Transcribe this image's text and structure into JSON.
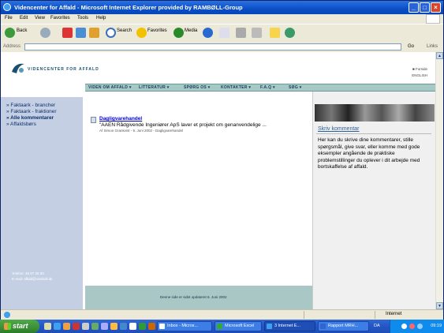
{
  "window": {
    "title": "Videncenter for Affald - Microsoft Internet Explorer provided by RAMBØLL-Group",
    "buttons": {
      "min": "_",
      "max": "□",
      "close": "×"
    }
  },
  "menu": [
    "File",
    "Edit",
    "View",
    "Favorites",
    "Tools",
    "Help"
  ],
  "toolbar": {
    "back": "Back",
    "search": "Search",
    "favorites": "Favorites",
    "media": "Media"
  },
  "address": {
    "label": "Address",
    "url": "",
    "go": "Go",
    "links": "Links"
  },
  "site": {
    "logo_text": "VIDENCENTER FOR AFFALD",
    "lang": [
      "■ Forside",
      "ENGLISH"
    ],
    "nav": [
      "VIDEN OM AFFALD ▾",
      "LITTERATUR ▾",
      "SPØRG OS ▾",
      "KONTAKTER ▾",
      "F.A.Q ▾",
      "SØG ▾"
    ],
    "sidebar": {
      "items": [
        "» Faktaark - brancher",
        "» Faktaark - fraktioner",
        "» Alle kommentarer",
        "» Affaldsbørs"
      ],
      "phone": "Telefon: 45 97 26 00",
      "email": "E-mail: affald@ramboll.dk"
    },
    "main": {
      "title": "Dagligvarehandel",
      "text": "\"AAEN Rådgivende Ingeniører ApS laver et projekt om genanvendelige ...",
      "meta": "Af Simon Grankvist - 9. Juni 2002 - Dagligvarehandel"
    },
    "footer": "Denne side er sidst opdateret 6. Juni 2002",
    "right": {
      "title": "Skriv kommentar",
      "text": "Her kan du skrive dine kommentarer, stille spørgsmål, give svar, eller komme med gode eksempler angående de praktiske problemstillinger du oplever i dit arbejde med bortskaffelse af affald."
    }
  },
  "status": {
    "zone": "Internet"
  },
  "taskbar": {
    "start": "start",
    "tasks": [
      "Inbox - Micros...",
      "Microsoft Excel",
      "3 Internet E...",
      "Rapport MRH..."
    ],
    "lang": "DA",
    "clock": "09:19"
  },
  "colors": {
    "nav_bg": "#a8c8c6",
    "sidebar_bg": "#c4cfe4",
    "link": "#0000cc"
  }
}
